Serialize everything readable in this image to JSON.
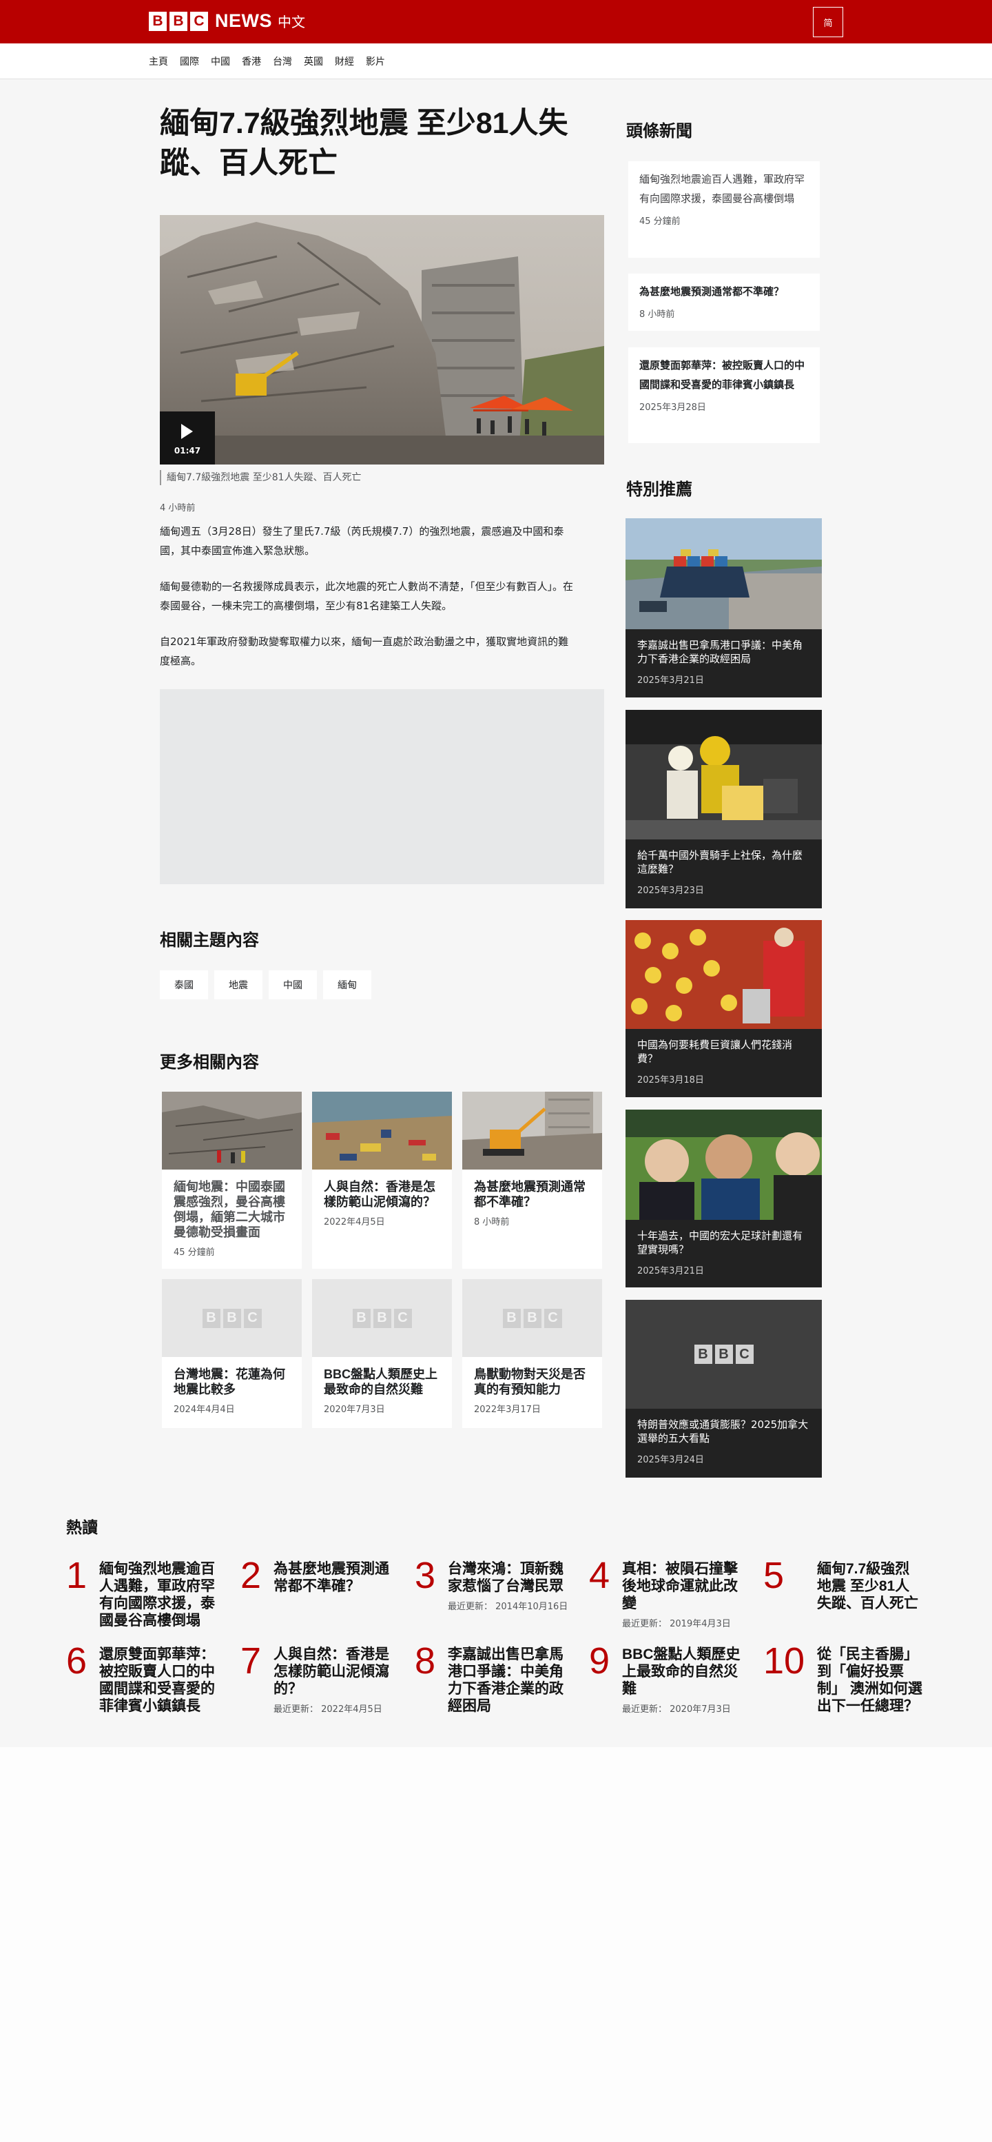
{
  "header": {
    "logo_letters": [
      "B",
      "B",
      "C"
    ],
    "news": "NEWS",
    "edition": "中文",
    "lang_button": "简"
  },
  "nav": {
    "items": [
      "主頁",
      "國際",
      "中國",
      "香港",
      "台灣",
      "英國",
      "財經",
      "影片"
    ]
  },
  "article": {
    "title": "緬甸7.7級強烈地震 至少81人失蹤、百人死亡",
    "video_duration": "01:47",
    "caption": "緬甸7.7級強烈地震 至少81人失蹤、百人死亡",
    "timestamp": "4 小時前",
    "paragraphs": [
      "緬甸週五（3月28日）發生了里氏7.7級（芮氏規模7.7）的強烈地震，震感遍及中國和泰國，其中泰國宣佈進入緊急狀態。",
      "緬甸曼德勒的一名救援隊成員表示，此次地震的死亡人數尚不清楚，「但至少有數百人」。在泰國曼谷，一棟未完工的高樓倒塌，至少有81名建築工人失蹤。",
      "自2021年軍政府發動政變奪取權力以來，緬甸一直處於政治動盪之中，獲取實地資訊的難度極高。"
    ]
  },
  "related_topics": {
    "title": "相關主題內容",
    "tags": [
      "泰國",
      "地震",
      "中國",
      "緬甸"
    ]
  },
  "more_content": {
    "title": "更多相關內容",
    "cards": [
      {
        "title": "緬甸地震：中國泰國震感強烈，曼谷高樓倒塌，緬第二大城市曼德勒受損畫面",
        "date": "45 分鐘前",
        "image": "rubble-rescue"
      },
      {
        "title": "人與自然：香港是怎樣防範山泥傾瀉的？",
        "date": "2022年4月5日",
        "image": "landslide"
      },
      {
        "title": "為甚麼地震預測通常都不準確？",
        "date": "8 小時前",
        "image": "excavator"
      },
      {
        "title": "台灣地震：花蓮為何地震比較多",
        "date": "2024年4月4日",
        "image": "bbc-placeholder"
      },
      {
        "title": "BBC盤點人類歷史上最致命的自然災難",
        "date": "2020年7月3日",
        "image": "bbc-placeholder"
      },
      {
        "title": "鳥獸動物對天災是否真的有預知能力",
        "date": "2022年3月17日",
        "image": "bbc-placeholder"
      }
    ]
  },
  "top_stories": {
    "title": "頭條新聞",
    "items": [
      {
        "title": "緬甸強烈地震逾百人遇難，軍政府罕有向國際求援，泰國曼谷高樓倒塌",
        "date": "45 分鐘前"
      },
      {
        "title": "為甚麼地震預測通常都不準確？",
        "date": "8 小時前"
      },
      {
        "title": "還原雙面郭華萍：被控販賣人口的中國間諜和受喜愛的菲律賓小鎮鎮長",
        "date": "2025年3月28日"
      }
    ]
  },
  "features": {
    "title": "特別推薦",
    "items": [
      {
        "title": "李嘉誠出售巴拿馬港口爭議：中美角力下香港企業的政經困局",
        "date": "2025年3月21日",
        "image": "canal-ship"
      },
      {
        "title": "給千萬中國外賣騎手上社保，為什麼這麼難？",
        "date": "2025年3月23日",
        "image": "delivery-rider"
      },
      {
        "title": "中國為何要耗費巨資讓人們花錢消費？",
        "date": "2025年3月18日",
        "image": "supermarket"
      },
      {
        "title": "十年過去，中國的宏大足球計劃還有望實現嗎？",
        "date": "2025年3月21日",
        "image": "football-selfie"
      },
      {
        "title": "特朗普效應或通貨膨脹？2025加拿大選舉的五大看點",
        "date": "2025年3月24日",
        "image": "bbc-placeholder"
      }
    ]
  },
  "most_read": {
    "title": "熱讀",
    "items": [
      {
        "rank": "1",
        "title": "緬甸強烈地震逾百人遇難，軍政府罕有向國際求援，泰國曼谷高樓倒塌",
        "date": ""
      },
      {
        "rank": "2",
        "title": "為甚麼地震預測通常都不準確？",
        "date": ""
      },
      {
        "rank": "3",
        "title": "台灣來鴻：頂新魏家惹惱了台灣民眾",
        "date": "最近更新： 2014年10月16日"
      },
      {
        "rank": "4",
        "title": "真相：被隕石撞擊後地球命運就此改變",
        "date": "最近更新： 2019年4月3日"
      },
      {
        "rank": "5",
        "title": "緬甸7.7級強烈地震 至少81人失蹤、百人死亡",
        "date": ""
      },
      {
        "rank": "6",
        "title": "還原雙面郭華萍：被控販賣人口的中國間諜和受喜愛的菲律賓小鎮鎮長",
        "date": ""
      },
      {
        "rank": "7",
        "title": "人與自然：香港是怎樣防範山泥傾瀉的？",
        "date": "最近更新： 2022年4月5日"
      },
      {
        "rank": "8",
        "title": "李嘉誠出售巴拿馬港口爭議：中美角力下香港企業的政經困局",
        "date": ""
      },
      {
        "rank": "9",
        "title": "BBC盤點人類歷史上最致命的自然災難",
        "date": "最近更新： 2020年7月3日"
      },
      {
        "rank": "10",
        "title": "從「民主香腸」到「偏好投票制」 澳洲如何選出下一任總理？",
        "date": ""
      }
    ]
  },
  "colors": {
    "brand": "#b80000",
    "page_bg": "#f6f6f6",
    "card_dark": "#222222"
  }
}
